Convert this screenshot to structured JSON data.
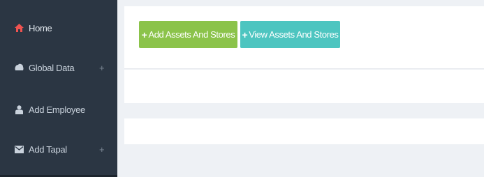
{
  "sidebar": {
    "items": [
      {
        "label": "Home",
        "icon": "home-icon",
        "expandable": false,
        "active": true
      },
      {
        "label": "Global Data",
        "icon": "database-icon",
        "expandable": true,
        "expand_glyph": "+"
      },
      {
        "label": "Add Employee",
        "icon": "user-icon",
        "expandable": false
      },
      {
        "label": "Add Tapal",
        "icon": "envelope-icon",
        "expandable": true,
        "expand_glyph": "+"
      }
    ]
  },
  "toolbar": {
    "add_label": "Add Assets And Stores",
    "view_label": "View Assets And Stores",
    "plus_glyph": "+"
  },
  "colors": {
    "sidebar_bg": "#2b3643",
    "home_icon": "#ef5350",
    "add_button": "#8bc34a",
    "view_button": "#4dc5c0",
    "content_bg": "#eef1f5"
  }
}
